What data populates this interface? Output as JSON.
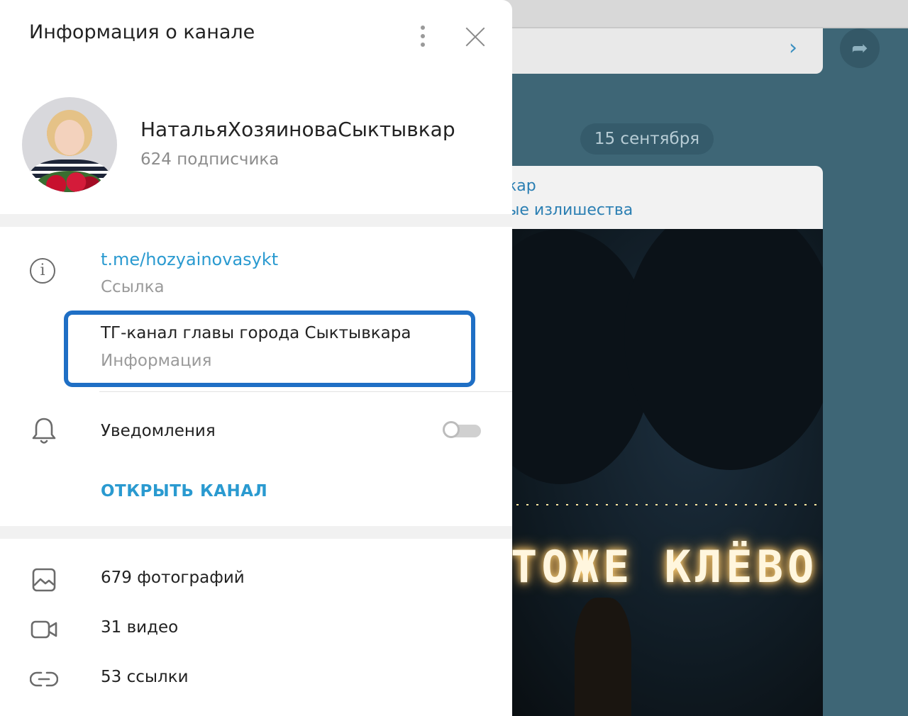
{
  "background": {
    "date_badge": "15 сентября",
    "message_line1": "кар",
    "message_line2": "ые излишества",
    "photo_sign_text": "ТОЖЕ КЛЁВО"
  },
  "panel": {
    "header": {
      "title": "Информация о канале"
    },
    "channel": {
      "name": "НатальяХозяиноваСыктывкар",
      "subscribers": "624 подписчика"
    },
    "info": {
      "link": "t.me/hozyainovasykt",
      "link_label": "Ссылка",
      "about": "ТГ-канал главы города Сыктывкара",
      "about_label": "Информация"
    },
    "notifications": {
      "label": "Уведомления",
      "enabled": false
    },
    "open_channel_label": "ОТКРЫТЬ КАНАЛ",
    "media": [
      {
        "icon": "photo-icon",
        "label": "679 фотографий"
      },
      {
        "icon": "video-icon",
        "label": "31 видео"
      },
      {
        "icon": "link-icon",
        "label": "53 ссылки"
      }
    ]
  },
  "colors": {
    "accent": "#2a9ad0",
    "highlight": "#1f6fc5",
    "chat_background": "#3e6676"
  }
}
